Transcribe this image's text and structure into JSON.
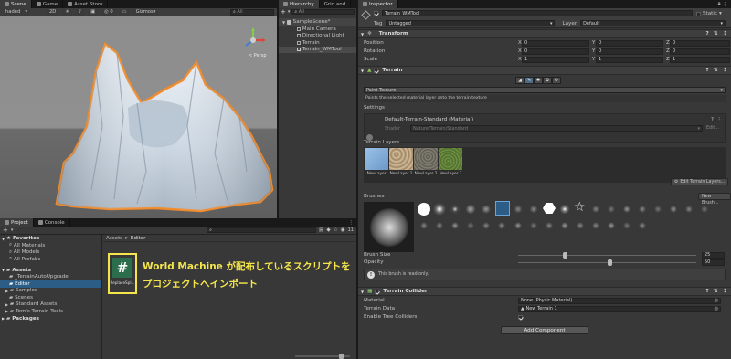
{
  "scene": {
    "tabs": [
      {
        "label": "Scene"
      },
      {
        "label": "Game"
      },
      {
        "label": "Asset Store"
      }
    ],
    "shading_mode": "haded",
    "mode_2d": "2D",
    "gizmos_label": "Gizmos",
    "search_placeholder": "All",
    "persp_label": "< Persp"
  },
  "hierarchy": {
    "tabs": [
      {
        "label": "Hierarchy"
      },
      {
        "label": "Grid and"
      }
    ],
    "add_label": "+",
    "search_placeholder": "All",
    "items": [
      {
        "label": "SampleScene*"
      },
      {
        "label": "Main Camera"
      },
      {
        "label": "Directional Light"
      },
      {
        "label": "Terrain"
      },
      {
        "label": "Terrain_WMTool"
      }
    ]
  },
  "inspector": {
    "tab_label": "Inspector",
    "object_name": "Terrain_WMTool",
    "static_label": "Static",
    "tag_label": "Tag",
    "tag_value": "Untagged",
    "layer_label": "Layer",
    "layer_value": "Default",
    "transform": {
      "title": "Transform",
      "rows": [
        {
          "label": "Position",
          "x": "0",
          "y": "0",
          "z": "0"
        },
        {
          "label": "Rotation",
          "x": "0",
          "y": "0",
          "z": "0"
        },
        {
          "label": "Scale",
          "x": "1",
          "y": "1",
          "z": "1"
        }
      ],
      "axis_x": "X",
      "axis_y": "Y",
      "axis_z": "Z"
    },
    "terrain": {
      "title": "Terrain",
      "tool_dropdown": "Paint Texture",
      "tool_help": "Paints the selected material layer onto the terrain texture",
      "settings_label": "Settings",
      "material_name": "Default-Terrain-Standard (Material)",
      "shader_label": "Shader",
      "shader_value": "Nature/Terrain/Standard",
      "edit_label": "Edit...",
      "layers_label": "Terrain Layers",
      "layers": [
        {
          "label": "NewLayer",
          "color": "#7aa6d6"
        },
        {
          "label": "NewLayer 1",
          "color": "#b49a76"
        },
        {
          "label": "NewLayer 2",
          "color": "#6d6a60"
        },
        {
          "label": "NewLayer 3",
          "color": "#5b7a3a"
        }
      ],
      "edit_layers_button": "Edit Terrain Layers...",
      "brushes_label": "Brushes",
      "new_brush_button": "New Brush...",
      "brush_size_label": "Brush Size",
      "brush_size_value": "25",
      "brush_size_fraction": 0.25,
      "opacity_label": "Opacity",
      "opacity_value": "50",
      "opacity_fraction": 0.5,
      "readonly_note": "This brush is read only."
    },
    "collider": {
      "title": "Terrain Collider",
      "rows": [
        {
          "label": "Material",
          "value": "None (Physic Material)"
        },
        {
          "label": "Terrain Data",
          "value": "New Terrain 1"
        },
        {
          "label": "Enable Tree Colliders",
          "value": ""
        }
      ]
    },
    "add_component_button": "Add Component"
  },
  "project": {
    "tabs": [
      {
        "label": "Project"
      },
      {
        "label": "Console"
      }
    ],
    "add_label": "+",
    "badge_count": "11",
    "favorites_label": "Favorites",
    "favorites": [
      {
        "label": "All Materials"
      },
      {
        "label": "All Models"
      },
      {
        "label": "All Prefabs"
      }
    ],
    "assets_label": "Assets",
    "folders": [
      {
        "label": "_TerrainAutoUpgrade"
      },
      {
        "label": "Editor"
      },
      {
        "label": "Samples"
      },
      {
        "label": "Scenes"
      },
      {
        "label": "Standard Assets"
      },
      {
        "label": "Tom's Terrain Tools"
      }
    ],
    "packages_label": "Packages",
    "breadcrumb": {
      "root": "Assets",
      "separator": ">",
      "current": "Editor"
    },
    "asset_file": {
      "glyph": "#",
      "label": "ReplaceSpl..."
    },
    "annotation_lines": [
      "World Machine が配布しているスクリプトを",
      "プロジェクトへインポート"
    ]
  },
  "colors": {
    "accent": "#2c5d87",
    "annotation": "#f4e64a",
    "panel": "#383838",
    "dark": "#191919"
  }
}
